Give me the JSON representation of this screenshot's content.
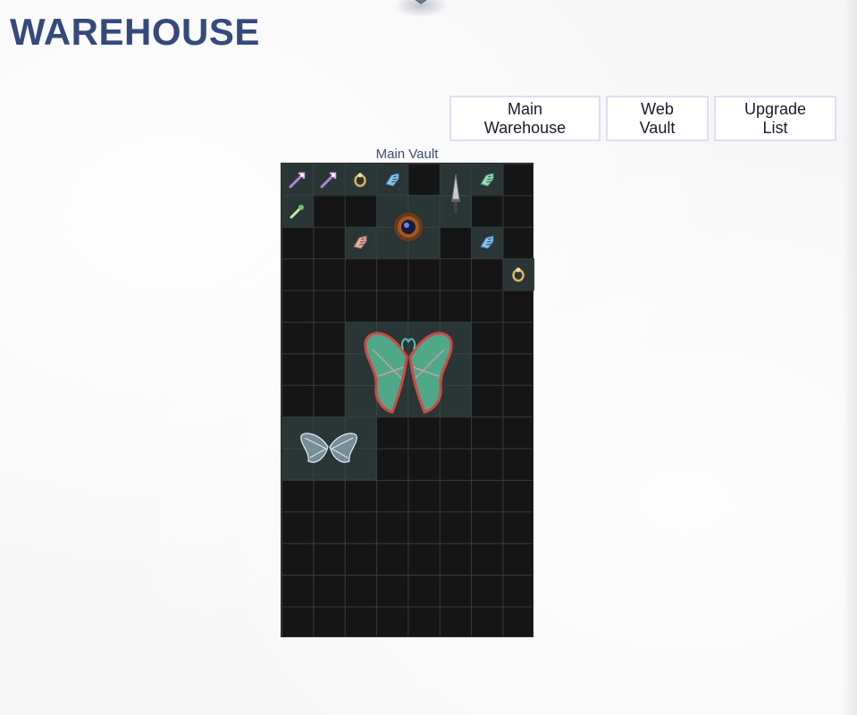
{
  "page": {
    "title": "WAREHOUSE"
  },
  "nav": {
    "buttons": [
      {
        "label": "Main Warehouse"
      },
      {
        "label": "Web Vault"
      },
      {
        "label": "Upgrade List"
      }
    ]
  },
  "vault": {
    "title": "Main Vault",
    "columns": 8,
    "rows": 15,
    "items": [
      {
        "icon": "purple-staff-icon",
        "col": 1,
        "row": 1,
        "w": 1,
        "h": 1
      },
      {
        "icon": "purple-staff-icon",
        "col": 2,
        "row": 1,
        "w": 1,
        "h": 1
      },
      {
        "icon": "jewel-ring-icon",
        "col": 3,
        "row": 1,
        "w": 1,
        "h": 1
      },
      {
        "icon": "blue-gauntlet-icon",
        "col": 4,
        "row": 1,
        "w": 1,
        "h": 1
      },
      {
        "icon": "dagger-icon",
        "col": 6,
        "row": 1,
        "w": 1,
        "h": 2
      },
      {
        "icon": "green-gauntlet-icon",
        "col": 7,
        "row": 1,
        "w": 1,
        "h": 1
      },
      {
        "icon": "green-wand-icon",
        "col": 1,
        "row": 2,
        "w": 1,
        "h": 1
      },
      {
        "icon": "dark-orb-shield-icon",
        "col": 4,
        "row": 2,
        "w": 2,
        "h": 2
      },
      {
        "icon": "pink-gauntlet-icon",
        "col": 3,
        "row": 3,
        "w": 1,
        "h": 1
      },
      {
        "icon": "blue-gauntlet-icon",
        "col": 7,
        "row": 3,
        "w": 1,
        "h": 1
      },
      {
        "icon": "jewel-ring-icon",
        "col": 8,
        "row": 4,
        "w": 1,
        "h": 1
      },
      {
        "icon": "fairy-wings-icon",
        "col": 3,
        "row": 6,
        "w": 4,
        "h": 3
      },
      {
        "icon": "crystal-wings-icon",
        "col": 1,
        "row": 9,
        "w": 3,
        "h": 2
      }
    ]
  }
}
